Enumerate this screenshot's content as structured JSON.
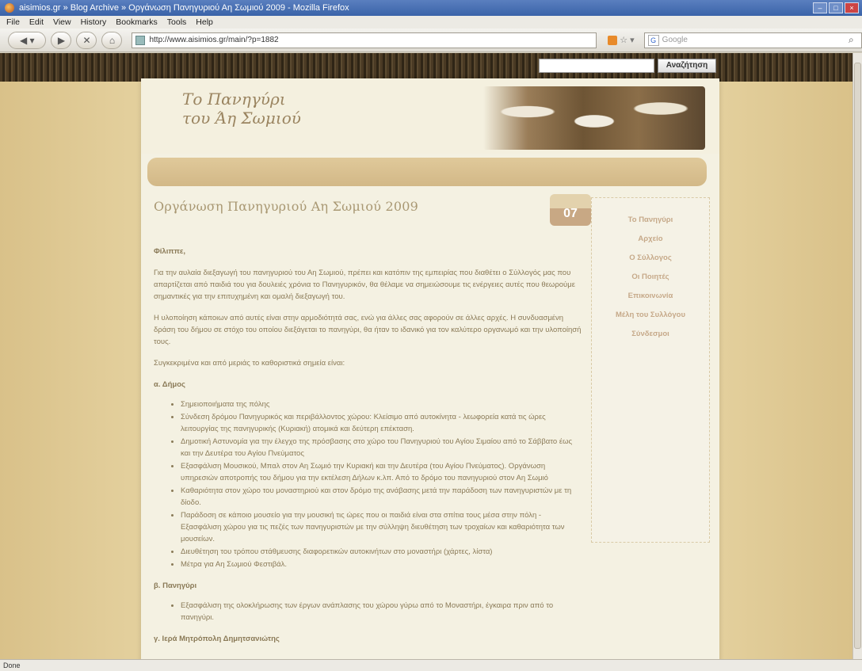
{
  "window": {
    "title": "aisimios.gr » Blog Archive » Οργάνωση Πανηγυριού Αη Σωμιού 2009 - Mozilla Firefox"
  },
  "menu": [
    "File",
    "Edit",
    "View",
    "History",
    "Bookmarks",
    "Tools",
    "Help"
  ],
  "navigation": {
    "url": "http://www.aisimios.gr/main/?p=1882",
    "search_placeholder": "Google"
  },
  "site": {
    "search_button": "Αναζήτηση",
    "logo_line1": "Το Πανηγύρι",
    "logo_line2": "του Άη Σωμιού"
  },
  "post": {
    "title": "Οργάνωση Πανηγυριού Αη Σωμιού 2009",
    "day": "07",
    "greeting": "Φίλιππε,",
    "paragraphs": [
      "Για την αυλαία διεξαγωγή του πανηγυριού του Αη Σωμιού, πρέπει και κατόπιν της εμπειρίας που διαθέτει ο Σύλλογός μας που απαρτίζεται από παιδιά του για δουλειές χρόνια το Πανηγυρικόν, θα θέλαμε να σημειώσουμε τις ενέργειες αυτές που θεωρούμε σημαντικές για την επιτυχημένη και ομαλή διεξαγωγή του.",
      "Η υλοποίηση κάποιων από αυτές είναι στην αρμοδιότητά σας, ενώ για άλλες σας αφορούν σε άλλες αρχές. Η συνδυασμένη δράση του δήμου σε στόχο του οποίου διεξάγεται το πανηγύρι, θα ήταν το ιδανικό για τον καλύτερο οργανωμό και την υλοποίησή τους.",
      "Συγκεκριμένα και από μεριάς το καθοριστικά σημεία είναι:"
    ],
    "section_a": "α. Δήμος",
    "bullets": [
      "Σημειοποιήματα της πόλης",
      "Σύνδεση δρόμου Πανηγυρικός και περιβάλλοντος χώρου: Κλείσιμο από αυτοκίνητα - λεωφορεία κατά τις ώρες λειτουργίας της πανηγυρικής (Κυριακή) ατομικά και δεύτερη επέκταση.",
      "Δημοτική Αστυνομία για την έλεγχο της πρόσβασης στο χώρο του Πανηγυριού του Αγίου Σιμαίου από το Σάββατο έως και την Δευτέρα του Αγίου Πνεύματος",
      "Εξασφάλιση Μουσικού, Μπαλ στον Αη Σωμιό την Κυριακή και την Δευτέρα (του Αγίου Πνεύματος). Οργάνωση υπηρεσιών αποτροπής του δήμου για την εκτέλεση Δήλων κ.λπ. Από το δρόμο του πανηγυριού στον Αη Σωμιό",
      "Καθαριότητα στον χώρο του μοναστηριού και στον δρόμο της ανάβασης μετά την παράδοση των πανηγυριστών με τη δίοδο.",
      "Παράδοση σε κάποιο μουσείο για την μουσική τις ώρες που οι παιδιά είναι στα σπίτια τους μέσα στην πόλη - Εξασφάλιση χώρου για τις πεζές των πανηγυριστών με την σύλληψη διευθέτηση των τροχαίων και καθαριότητα των μουσείων.",
      "Διευθέτηση του τρόπου στάθμευσης διαφορετικών αυτοκινήτων στο μοναστήρι (χάρτες, λίστα)",
      "Μέτρα για Αη Σωμιού Φεστιβάλ."
    ],
    "section_b": "β. Πανηγύρι",
    "bullets_b": [
      "Εξασφάλιση της ολοκλήρωσης των έργων ανάπλασης του χώρου γύρω από το Μοναστήρι, έγκαιρα πριν από το πανηγύρι."
    ],
    "section_c": "γ. Ιερά Μητρόπολη Δημητσανιώτης"
  },
  "sidebar": {
    "items": [
      "Το Πανηγύρι",
      "Αρχείο",
      "Ο Σύλλογος",
      "Οι Ποιητές",
      "Επικοινωνία",
      "Μέλη του Συλλόγου",
      "Σύνδεσμοι"
    ]
  },
  "status": "Done"
}
